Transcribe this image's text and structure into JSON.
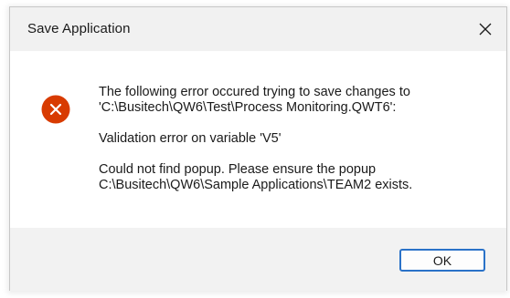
{
  "dialog": {
    "title": "Save Application",
    "close_icon": "close-icon",
    "error_icon": "error-icon",
    "message": {
      "line1": "The following error occured trying to save changes to\n'C:\\Busitech\\QW6\\Test\\Process Monitoring.QWT6':",
      "line2": "Validation error on variable 'V5'",
      "line3": "Could not find popup. Please ensure the popup\nC:\\Busitech\\QW6\\Sample Applications\\TEAM2 exists."
    },
    "ok_label": "OK"
  },
  "colors": {
    "error_icon": "#d83b01",
    "accent": "#2a72c8",
    "titlebar_bg": "#f1f1f1",
    "footer_bg": "#f2f2f2"
  }
}
